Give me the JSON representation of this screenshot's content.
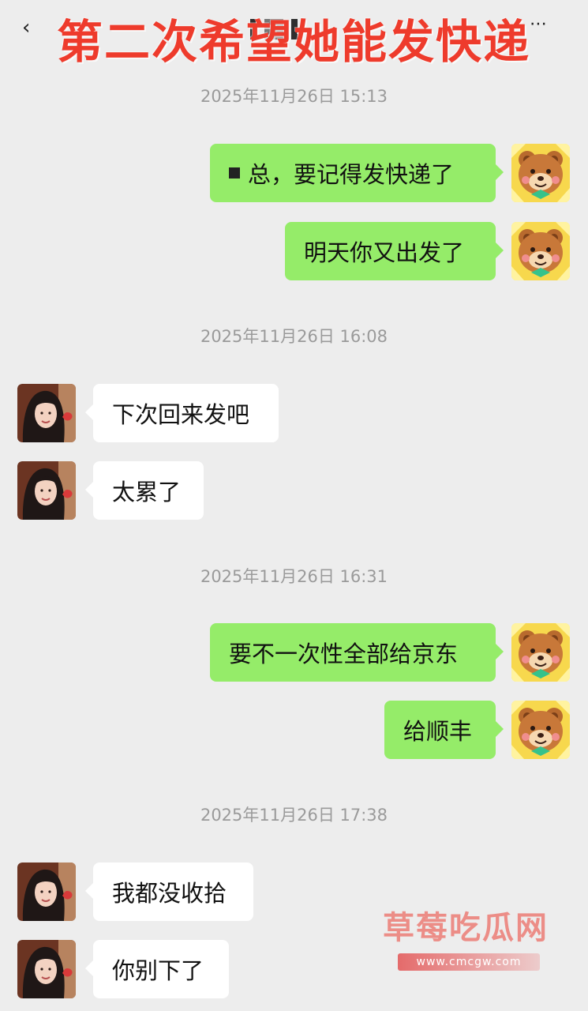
{
  "header": {
    "title": "第二次希望她能发快递",
    "back_icon": "back-icon",
    "more_icon": "more-icon"
  },
  "timestamps": [
    "2025年11月26日 15:13",
    "2025年11月26日 16:08",
    "2025年11月26日 16:31",
    "2025年11月26日 17:38"
  ],
  "messages": [
    {
      "side": "right",
      "text": "总，要记得发快递了"
    },
    {
      "side": "right",
      "text": "明天你又出发了"
    },
    {
      "side": "left",
      "text": "下次回来发吧"
    },
    {
      "side": "left",
      "text": "太累了"
    },
    {
      "side": "right",
      "text": "要不一次性全部给京东"
    },
    {
      "side": "right",
      "text": "给顺丰"
    },
    {
      "side": "left",
      "text": "我都没收拾"
    },
    {
      "side": "left",
      "text": "你别下了"
    }
  ],
  "watermark": {
    "title": "草莓吃瓜网",
    "url": "www.cmcgw.com"
  },
  "colors": {
    "background": "#ededed",
    "right_bubble": "#95ec69",
    "left_bubble": "#ffffff",
    "title": "#ee3b2c",
    "time": "#9a9a9a"
  }
}
